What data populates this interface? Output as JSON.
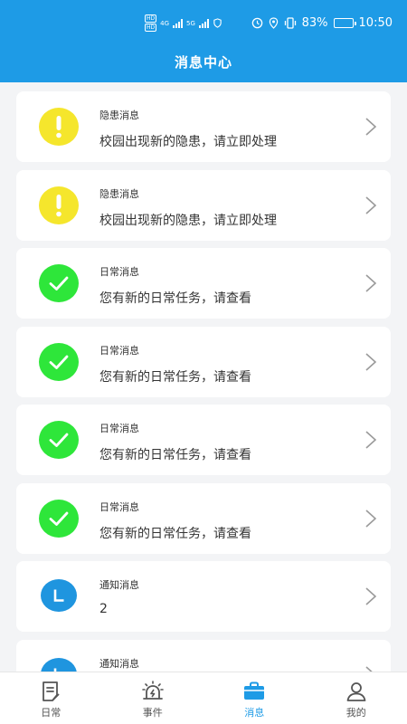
{
  "status_bar": {
    "hd_badges": [
      "HD",
      "HD"
    ],
    "network_labels": [
      "4G",
      "5G"
    ],
    "battery_percent": "83%",
    "battery_level": 0.83,
    "time": "10:50"
  },
  "header": {
    "title": "消息中心"
  },
  "messages": [
    {
      "type": "warning",
      "title": "隐患消息",
      "body": "校园出现新的隐患，请立即处理"
    },
    {
      "type": "warning",
      "title": "隐患消息",
      "body": "校园出现新的隐患，请立即处理"
    },
    {
      "type": "daily",
      "title": "日常消息",
      "body": "您有新的日常任务，请查看"
    },
    {
      "type": "daily",
      "title": "日常消息",
      "body": "您有新的日常任务，请查看"
    },
    {
      "type": "daily",
      "title": "日常消息",
      "body": "您有新的日常任务，请查看"
    },
    {
      "type": "daily",
      "title": "日常消息",
      "body": "您有新的日常任务，请查看"
    },
    {
      "type": "notice",
      "title": "通知消息",
      "body": "2"
    },
    {
      "type": "notice",
      "title": "通知消息",
      "body": ""
    }
  ],
  "tabs": [
    {
      "label": "日常",
      "icon": "daily-doc-icon"
    },
    {
      "label": "事件",
      "icon": "alarm-icon"
    },
    {
      "label": "消息",
      "icon": "message-briefcase-icon"
    },
    {
      "label": "我的",
      "icon": "person-icon"
    }
  ],
  "colors": {
    "header": "#1e9be6",
    "warning": "#f5e62c",
    "daily": "#2ee63a",
    "notice": "#1f95df",
    "active_tab": "#1e9be6"
  }
}
